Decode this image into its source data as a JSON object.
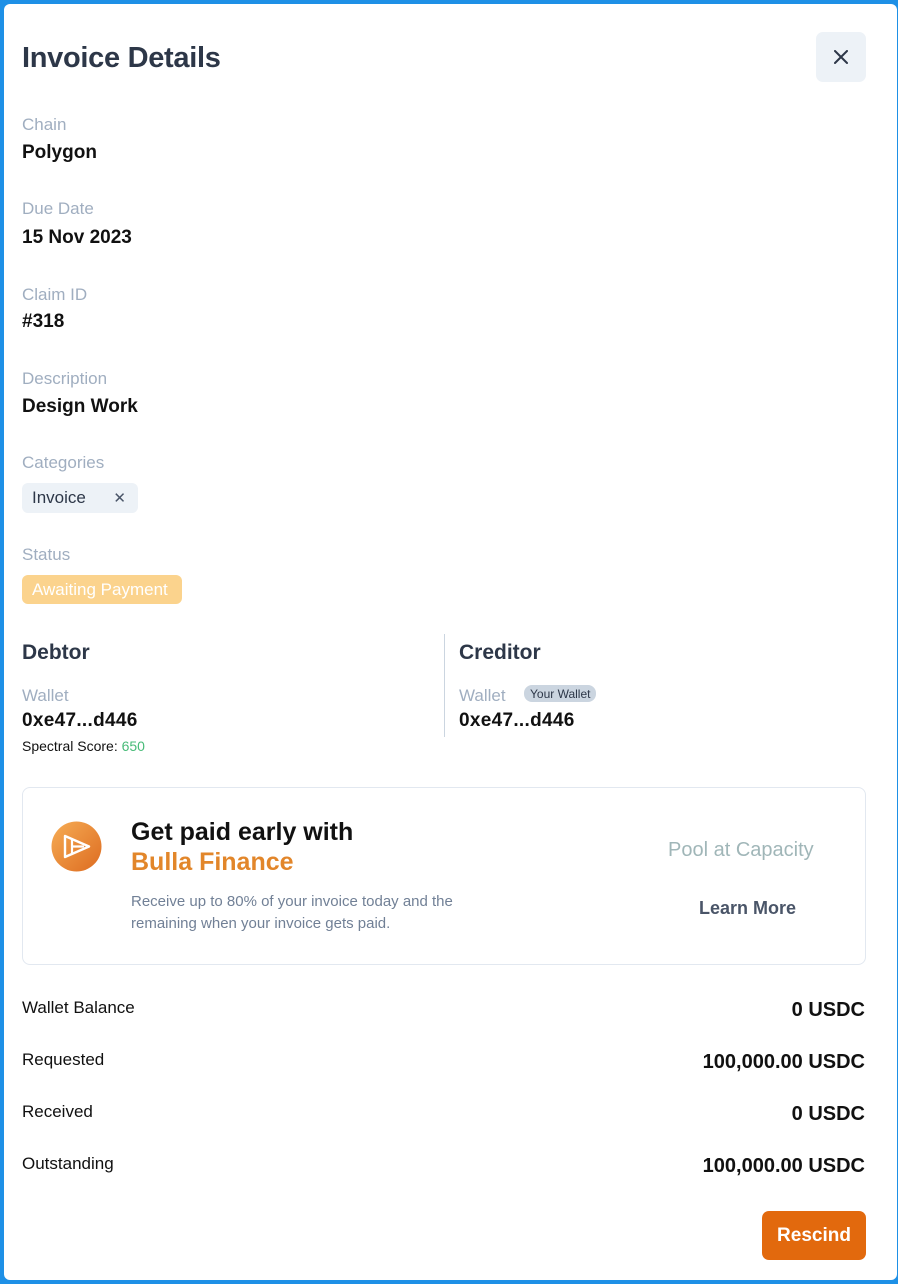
{
  "modal": {
    "title": "Invoice Details"
  },
  "fields": {
    "chain": {
      "label": "Chain",
      "value": "Polygon"
    },
    "due_date": {
      "label": "Due Date",
      "value": "15 Nov 2023"
    },
    "claim_id": {
      "label": "Claim ID",
      "value": "#318"
    },
    "description": {
      "label": "Description",
      "value": "Design Work"
    },
    "categories": {
      "label": "Categories",
      "tags": [
        "Invoice"
      ]
    },
    "status": {
      "label": "Status",
      "value": "Awaiting Payment"
    }
  },
  "debtor": {
    "title": "Debtor",
    "wallet_label": "Wallet",
    "wallet_address": "0xe47...d446",
    "spectral_label": "Spectral Score:",
    "spectral_score": "650"
  },
  "creditor": {
    "title": "Creditor",
    "wallet_label": "Wallet",
    "wallet_badge": "Your Wallet",
    "wallet_address": "0xe47...d446"
  },
  "promo": {
    "title_line1": "Get paid early with",
    "title_line2": "Bulla Finance",
    "description": "Receive up to 80% of your invoice today and the remaining when your invoice gets paid.",
    "pool_status": "Pool at Capacity",
    "learn_more": "Learn More",
    "logo_icon": "bulla-finance-logo-icon"
  },
  "summary": [
    {
      "label": "Wallet Balance",
      "value": "0 USDC"
    },
    {
      "label": "Requested",
      "value": "100,000.00 USDC"
    },
    {
      "label": "Received",
      "value": "0 USDC"
    },
    {
      "label": "Outstanding",
      "value": "100,000.00 USDC"
    }
  ],
  "actions": {
    "rescind_label": "Rescind"
  },
  "colors": {
    "accent_orange": "#e2690d",
    "brand_orange_text": "#e2862a",
    "status_badge_bg": "#fbd38d",
    "score_green": "#48bb78",
    "frame_blue": "#1e90e6"
  }
}
